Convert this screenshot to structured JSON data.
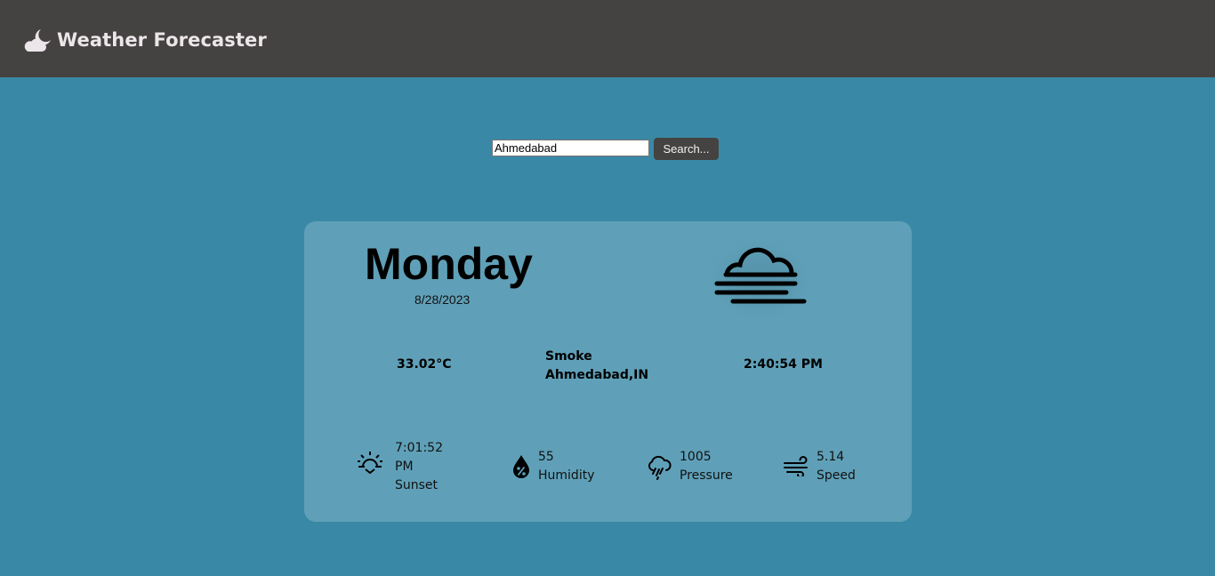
{
  "app": {
    "title": "Weather Forecaster",
    "logo_icon": "cloud-moon-icon"
  },
  "search": {
    "value": "Ahmedabad",
    "button_label": "Search..."
  },
  "weather": {
    "day": "Monday",
    "date": "8/28/2023",
    "condition_icon": "fog-icon",
    "temperature": "33.02°C",
    "condition": "Smoke",
    "location": "Ahmedabad,IN",
    "time": "2:40:54 PM"
  },
  "stats": {
    "sunset": {
      "icon": "sunset-icon",
      "value_line1": "7:01:52",
      "value_line2": "PM",
      "label": "Sunset"
    },
    "humidity": {
      "icon": "humidity-icon",
      "value": "55",
      "label": "Humidity"
    },
    "pressure": {
      "icon": "rain-cloud-icon",
      "value": "1005",
      "label": "Pressure"
    },
    "speed": {
      "icon": "wind-icon",
      "value": "5.14",
      "label": "Speed"
    }
  },
  "colors": {
    "page_background": "#3989a6",
    "navbar": "#454341",
    "card": "#5fa0b8",
    "brand_text": "#ece6ea"
  }
}
